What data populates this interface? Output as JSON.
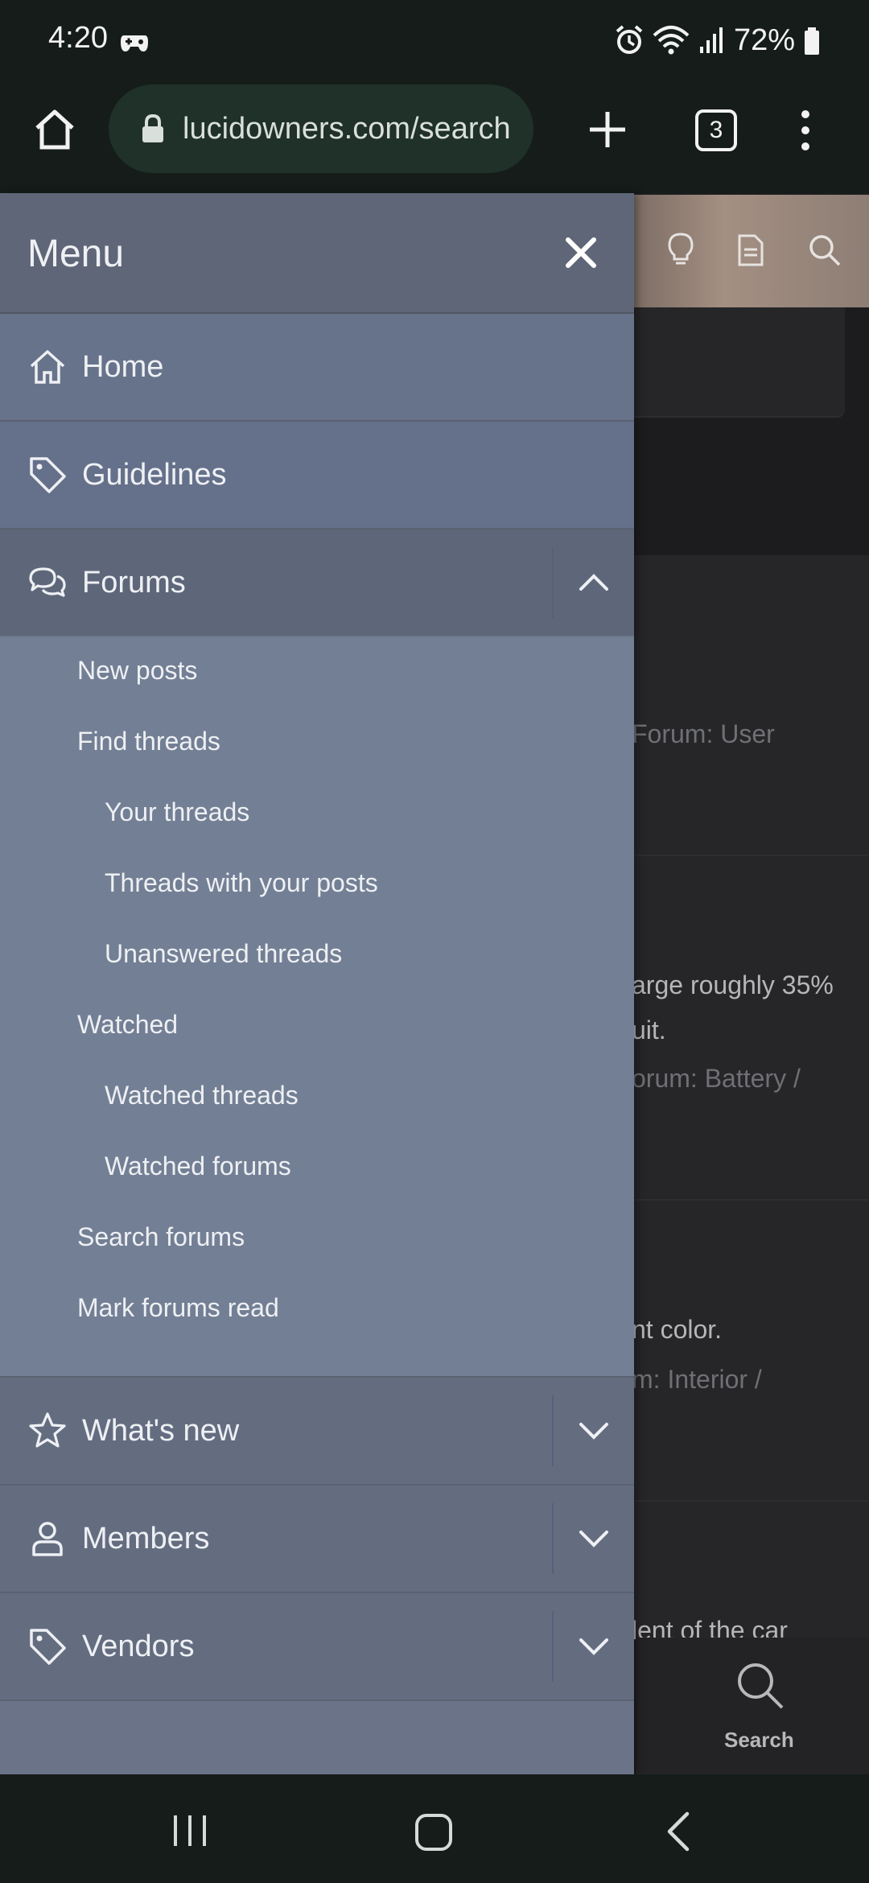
{
  "status_bar": {
    "time": "4:20",
    "battery": "72%"
  },
  "browser": {
    "url": "lucidowners.com/search",
    "tab_count": "3"
  },
  "background_page": {
    "snippets": [
      "Forum: User",
      "arge roughly 35%",
      "uit.",
      "orum: Battery /",
      "nt color.",
      "m: Interior /",
      "lent of the car"
    ],
    "bottom_search_label": "Search"
  },
  "drawer": {
    "title": "Menu",
    "items": [
      {
        "label": "Home"
      },
      {
        "label": "Guidelines"
      },
      {
        "label": "Forums"
      },
      {
        "label": "What's new"
      },
      {
        "label": "Members"
      },
      {
        "label": "Vendors"
      }
    ],
    "forums_submenu": [
      {
        "label": "New posts"
      },
      {
        "label": "Find threads"
      },
      {
        "label": "Your threads"
      },
      {
        "label": "Threads with your posts"
      },
      {
        "label": "Unanswered threads"
      },
      {
        "label": "Watched"
      },
      {
        "label": "Watched threads"
      },
      {
        "label": "Watched forums"
      },
      {
        "label": "Search forums"
      },
      {
        "label": "Mark forums read"
      }
    ]
  }
}
